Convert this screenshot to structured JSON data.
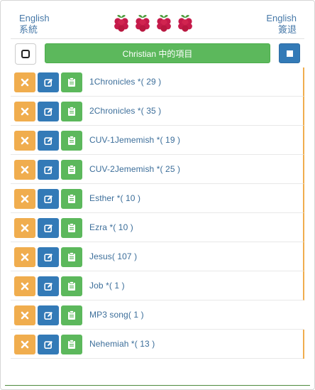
{
  "header": {
    "left_line1": "English",
    "left_line2": "系統",
    "right_line1": "English",
    "right_line2": "簽退",
    "logo_icon": "raspberry-icon",
    "logo_count": 4
  },
  "toolbar": {
    "select_all_icon": "checkbox-icon",
    "title": "Christian 中的項目",
    "stop_icon": "stop-icon"
  },
  "colors": {
    "warning": "#f0ad4e",
    "primary": "#337ab7",
    "success": "#5cb85c",
    "link_text": "#3c6e9a"
  },
  "items": [
    {
      "label": "1Chronicles *( 29 )"
    },
    {
      "label": "2Chronicles *( 35 )"
    },
    {
      "label": "CUV-1Jememish *( 19 )"
    },
    {
      "label": "CUV-2Jememish *( 25 )"
    },
    {
      "label": "Esther *( 10 )"
    },
    {
      "label": "Ezra *( 10 )"
    },
    {
      "label": "Jesus( 107 )"
    },
    {
      "label": "Job *( 1 )"
    },
    {
      "label": "MP3 song( 1 )"
    },
    {
      "label": "Nehemiah *( 13 )"
    }
  ],
  "row_icons": {
    "delete": "close-icon",
    "edit": "edit-icon",
    "copy": "clipboard-icon"
  }
}
